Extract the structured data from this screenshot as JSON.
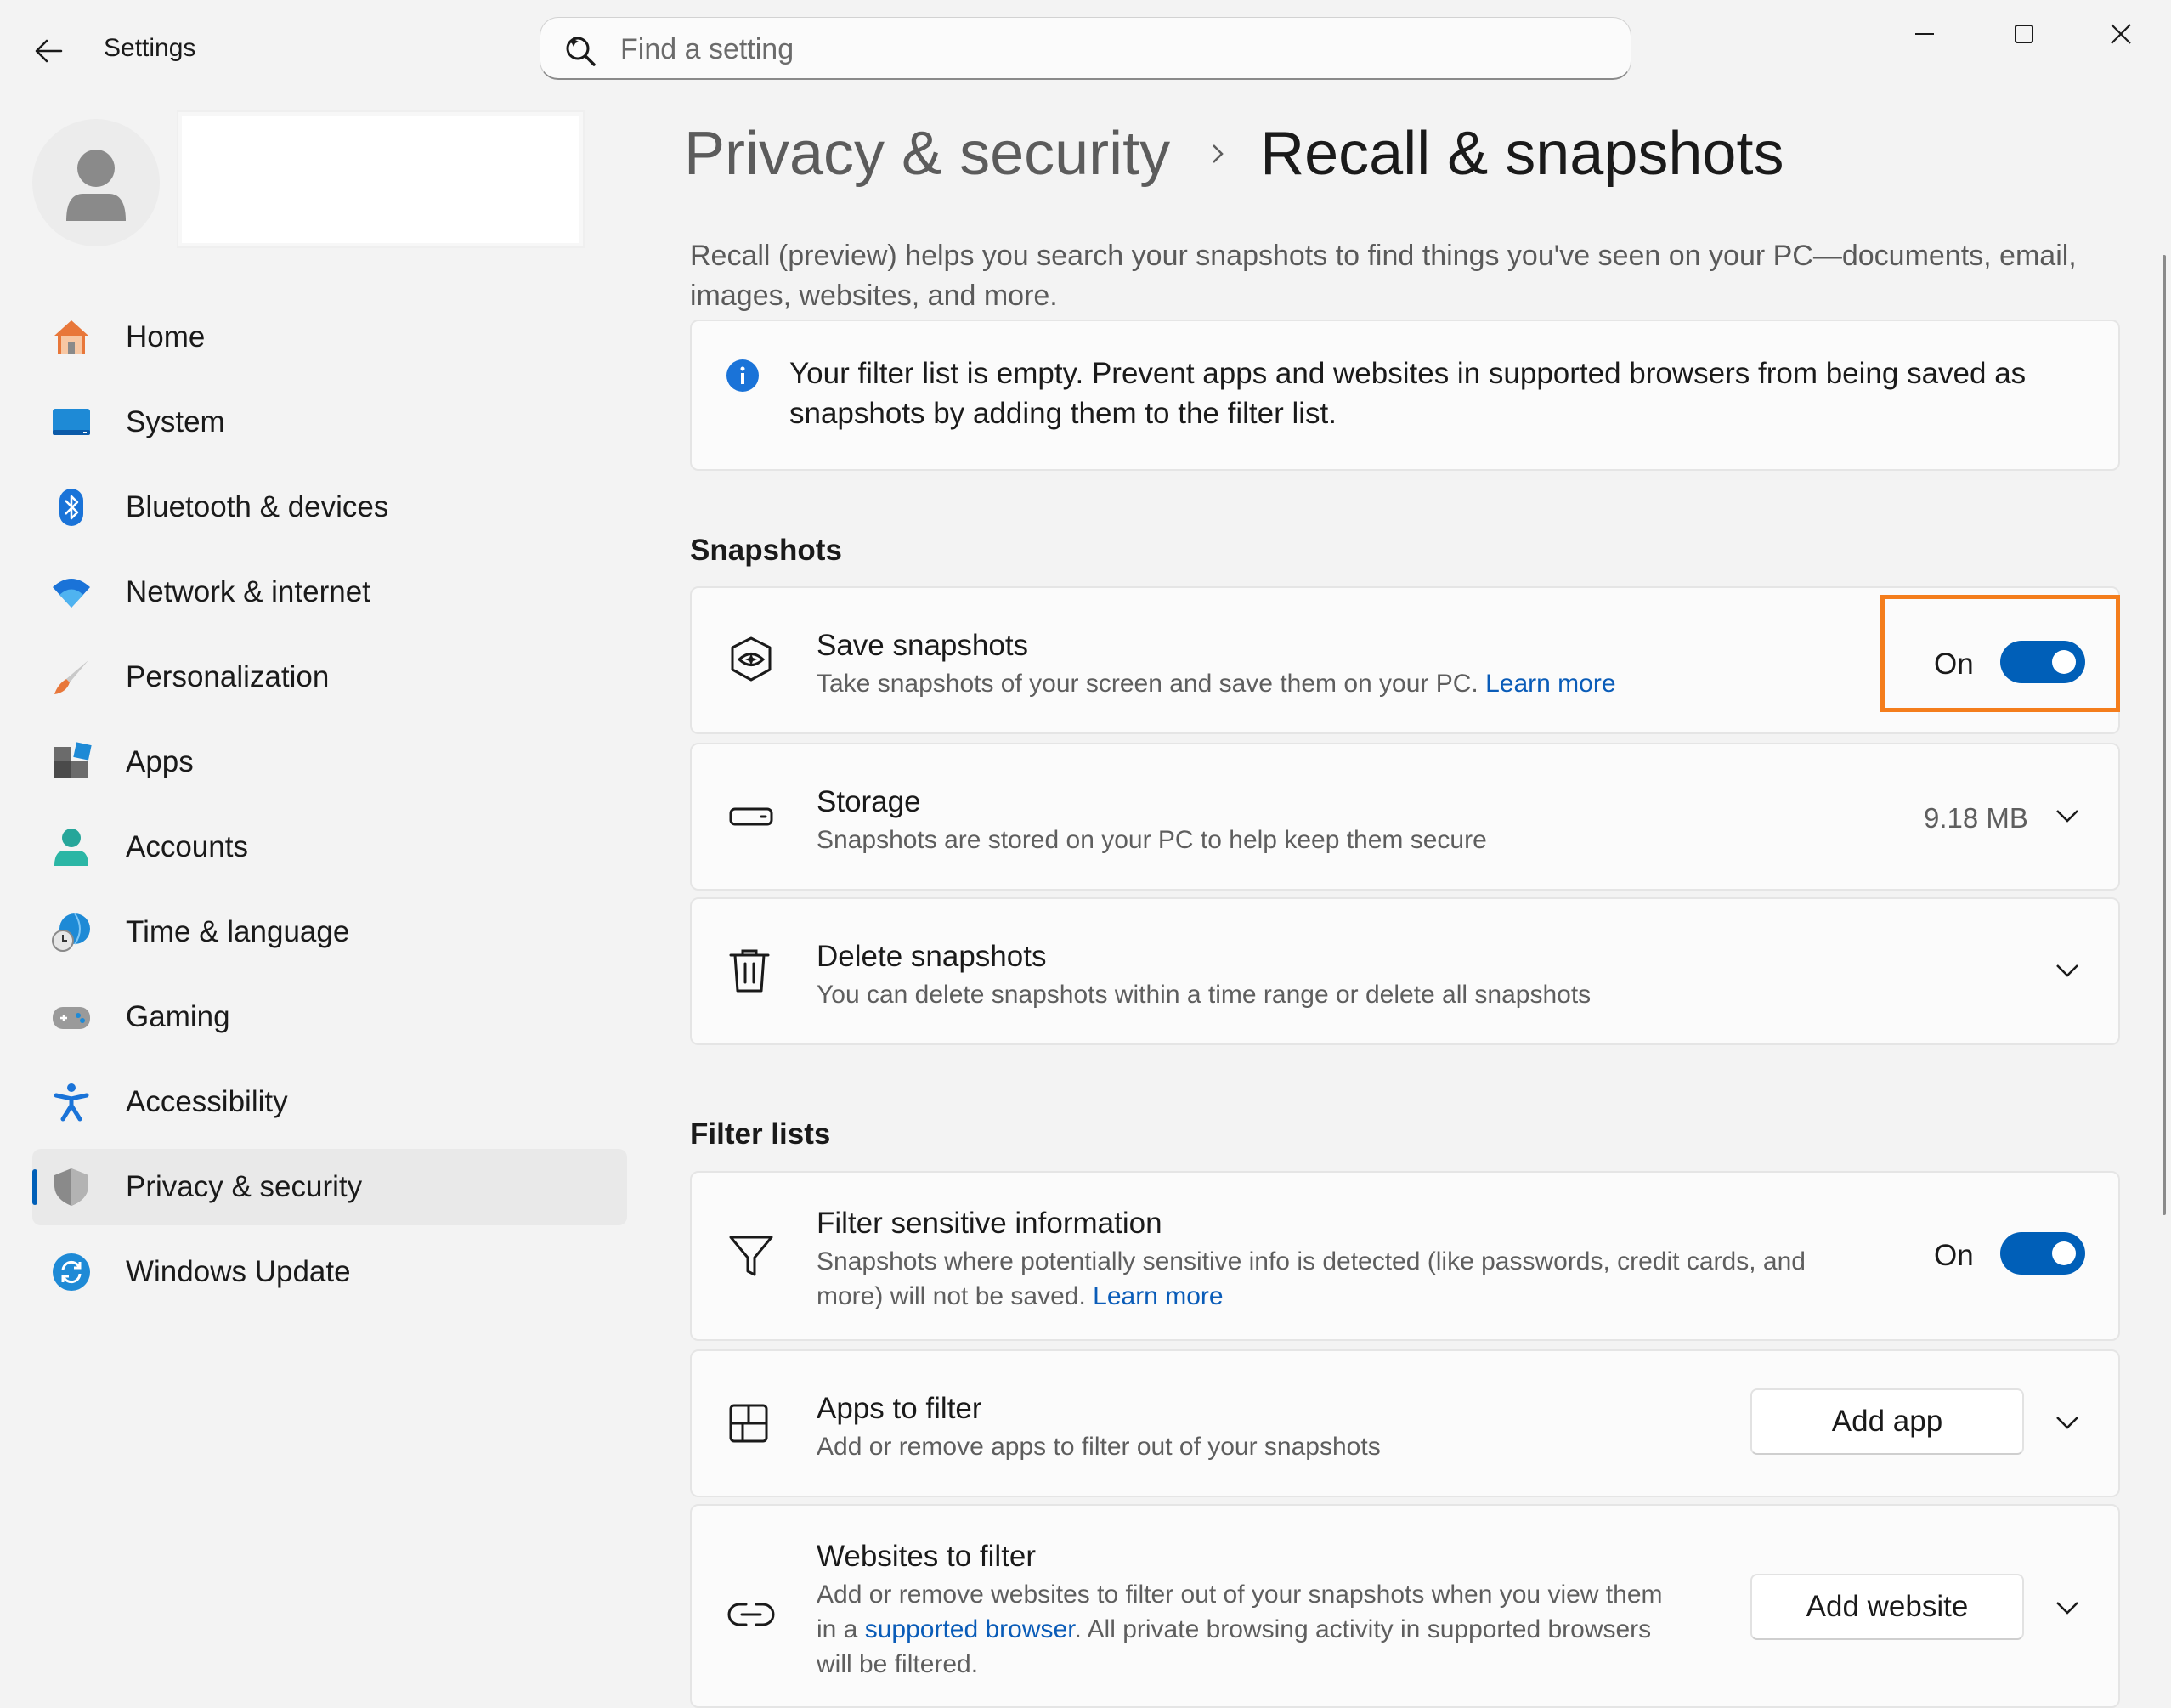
{
  "window": {
    "title": "Settings",
    "controls": [
      "minimize-icon",
      "maximize-icon",
      "close-icon"
    ]
  },
  "search": {
    "placeholder": "Find a setting"
  },
  "sidebar": {
    "items": [
      {
        "label": "Home",
        "icon": "home-icon"
      },
      {
        "label": "System",
        "icon": "system-icon"
      },
      {
        "label": "Bluetooth & devices",
        "icon": "bluetooth-icon"
      },
      {
        "label": "Network & internet",
        "icon": "wifi-icon"
      },
      {
        "label": "Personalization",
        "icon": "brush-icon"
      },
      {
        "label": "Apps",
        "icon": "apps-icon"
      },
      {
        "label": "Accounts",
        "icon": "accounts-icon"
      },
      {
        "label": "Time & language",
        "icon": "globe-clock-icon"
      },
      {
        "label": "Gaming",
        "icon": "gamepad-icon"
      },
      {
        "label": "Accessibility",
        "icon": "accessibility-icon"
      },
      {
        "label": "Privacy & security",
        "icon": "shield-icon",
        "selected": true
      },
      {
        "label": "Windows Update",
        "icon": "update-icon"
      }
    ]
  },
  "breadcrumb": {
    "parent": "Privacy & security",
    "current": "Recall & snapshots"
  },
  "intro": "Recall (preview) helps you search your snapshots to find things you've seen on your PC—documents, email, images, websites, and more.",
  "info_banner": "Your filter list is empty. Prevent apps and websites in supported browsers from being saved as snapshots by adding them to the filter list.",
  "snapshots": {
    "section_title": "Snapshots",
    "save": {
      "title": "Save snapshots",
      "desc": "Take snapshots of your screen and save them on your PC. ",
      "link": "Learn more",
      "state": "On"
    },
    "storage": {
      "title": "Storage",
      "desc": "Snapshots are stored on your PC to help keep them secure",
      "value": "9.18 MB"
    },
    "delete": {
      "title": "Delete snapshots",
      "desc": "You can delete snapshots within a time range or delete all snapshots"
    }
  },
  "filters": {
    "section_title": "Filter lists",
    "sensitive": {
      "title": "Filter sensitive information",
      "desc_line1": "Snapshots where potentially sensitive info is detected (like passwords, credit cards, and",
      "desc_line2": "more) will not be saved. ",
      "link": "Learn more",
      "state": "On"
    },
    "apps": {
      "title": "Apps to filter",
      "desc": "Add or remove apps to filter out of your snapshots",
      "button": "Add app"
    },
    "websites": {
      "title": "Websites to filter",
      "desc_line1": "Add or remove websites to filter out of your snapshots when you view them",
      "desc_line2_prefix": "in a ",
      "desc_line2_link": "supported browser",
      "desc_line2_suffix": ". All private browsing activity in supported browsers",
      "desc_line3": "will be filtered.",
      "button": "Add website"
    }
  },
  "colors": {
    "accent": "#005fb8",
    "highlight": "#f47d1c",
    "link": "#0a5cb8"
  }
}
